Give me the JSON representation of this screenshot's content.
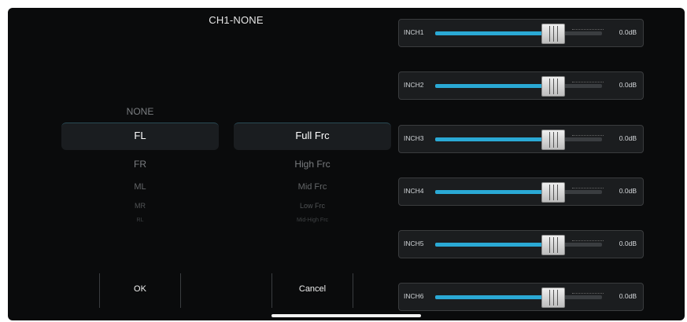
{
  "dialog": {
    "title": "CH1-NONE"
  },
  "picker_channel": {
    "items": [
      "NONE",
      "FL",
      "FR",
      "ML",
      "MR",
      "RL"
    ],
    "selected_index": 1
  },
  "picker_freq": {
    "items": [
      "Full Frc",
      "High Frc",
      "Mid Frc",
      "Low Frc",
      "Mid-High Frc"
    ],
    "selected_index": 0
  },
  "buttons": {
    "ok": "OK",
    "cancel": "Cancel"
  },
  "channels": [
    {
      "name": "INCH1",
      "gain": "0.0dB",
      "level": 0.65
    },
    {
      "name": "INCH2",
      "gain": "0.0dB",
      "level": 0.65
    },
    {
      "name": "INCH3",
      "gain": "0.0dB",
      "level": 0.65
    },
    {
      "name": "INCH4",
      "gain": "0.0dB",
      "level": 0.65
    },
    {
      "name": "INCH5",
      "gain": "0.0dB",
      "level": 0.65
    },
    {
      "name": "INCH6",
      "gain": "0.0dB",
      "level": 0.65
    }
  ],
  "colors": {
    "accent": "#2aa9d5",
    "background": "#0a0b0c"
  }
}
